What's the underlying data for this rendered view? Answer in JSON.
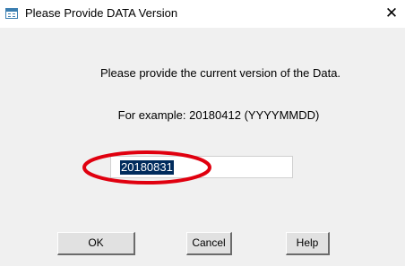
{
  "window": {
    "title": "Please Provide DATA Version",
    "close_symbol": "✕"
  },
  "dialog": {
    "prompt": "Please provide the current version of the Data.",
    "example": "For example:  20180412 (YYYYMMDD)",
    "version_input": {
      "value": "20180831",
      "selected": true
    },
    "annotation": {
      "shape": "ellipse",
      "color": "#e0000f"
    }
  },
  "buttons": {
    "ok_label": "OK",
    "cancel_label": "Cancel",
    "help_label": "Help"
  },
  "colors": {
    "dialog_background": "#f0f0f0",
    "selection_background": "#002b5c",
    "annotation_red": "#e0000f"
  }
}
